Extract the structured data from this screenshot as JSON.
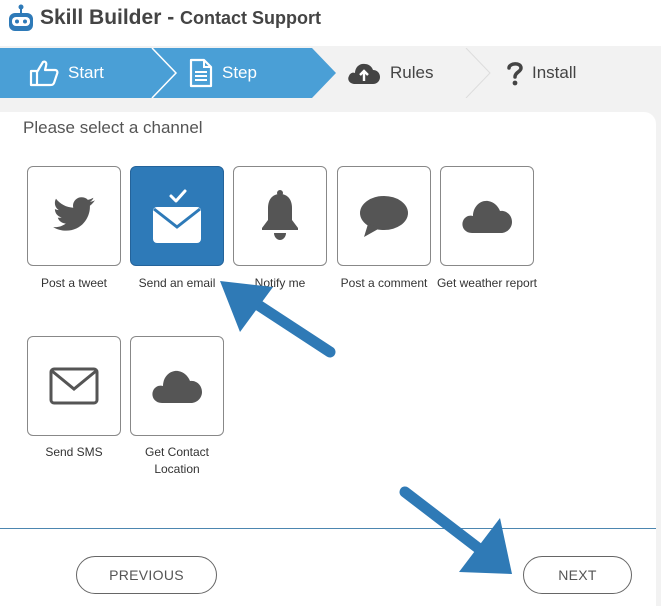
{
  "app": {
    "name": "Skill Builder",
    "separator": " - ",
    "subtitle": "Contact Support"
  },
  "wizard": {
    "steps": [
      {
        "label": "Start",
        "icon": "thumbs-up-icon",
        "state": "done"
      },
      {
        "label": "Step",
        "icon": "document-icon",
        "state": "current"
      },
      {
        "label": "Rules",
        "icon": "cloud-upload-icon",
        "state": "upcoming"
      },
      {
        "label": "Install",
        "icon": "question-mark-icon",
        "state": "upcoming"
      }
    ]
  },
  "panel": {
    "title": "Please select a channel"
  },
  "channels": [
    {
      "label": "Post a tweet",
      "icon": "twitter-bird-icon",
      "selected": false
    },
    {
      "label": "Send an email",
      "icon": "envelope-check-icon",
      "selected": true
    },
    {
      "label": "Notify me",
      "icon": "bell-icon",
      "selected": false
    },
    {
      "label": "Post a comment",
      "icon": "speech-bubble-icon",
      "selected": false
    },
    {
      "label": "Get weather report",
      "icon": "cloud-icon",
      "selected": false
    },
    {
      "label": "Send SMS",
      "icon": "envelope-icon",
      "selected": false
    },
    {
      "label": "Get Contact Location",
      "icon": "cloud-icon",
      "selected": false
    }
  ],
  "buttons": {
    "previous": "PREVIOUS",
    "next": "NEXT"
  },
  "colors": {
    "accent": "#4a9fd6",
    "selected": "#2e7ab8",
    "arrow": "#2f7ab6",
    "inactive_step": "#ffffff",
    "icon_gray": "#555555"
  }
}
